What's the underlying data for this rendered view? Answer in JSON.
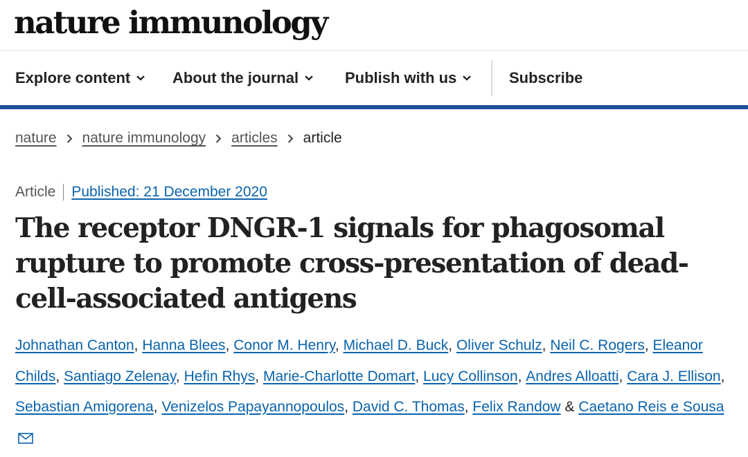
{
  "masthead": {
    "logo": "nature immunology"
  },
  "nav": {
    "items": [
      {
        "label": "Explore content",
        "has_dropdown": true
      },
      {
        "label": "About the journal",
        "has_dropdown": true
      },
      {
        "label": "Publish with us",
        "has_dropdown": true
      },
      {
        "label": "Subscribe",
        "has_dropdown": false
      }
    ]
  },
  "breadcrumbs": {
    "items": [
      "nature",
      "nature immunology",
      "articles"
    ],
    "current": "article"
  },
  "article": {
    "type": "Article",
    "published": "Published: 21 December 2020",
    "title": "The receptor DNGR-1 signals for phagosomal rupture to promote cross-presentation of dead-cell-associated antigens",
    "authors": [
      "Johnathan Canton",
      "Hanna Blees",
      "Conor M. Henry",
      "Michael D. Buck",
      "Oliver Schulz",
      "Neil C. Rogers",
      "Eleanor Childs",
      "Santiago Zelenay",
      "Hefin Rhys",
      "Marie-Charlotte Domart",
      "Lucy Collinson",
      "Andres Alloatti",
      "Cara J. Ellison",
      "Sebastian Amigorena",
      "Venizelos Papayannopoulos",
      "David C. Thomas",
      "Felix Randow",
      "Caetano Reis e Sousa"
    ],
    "author_joiner": "&",
    "corresponding_icon": "mail-icon"
  },
  "colors": {
    "accent_rule": "#1f4f9c",
    "link": "#0a63ad"
  }
}
